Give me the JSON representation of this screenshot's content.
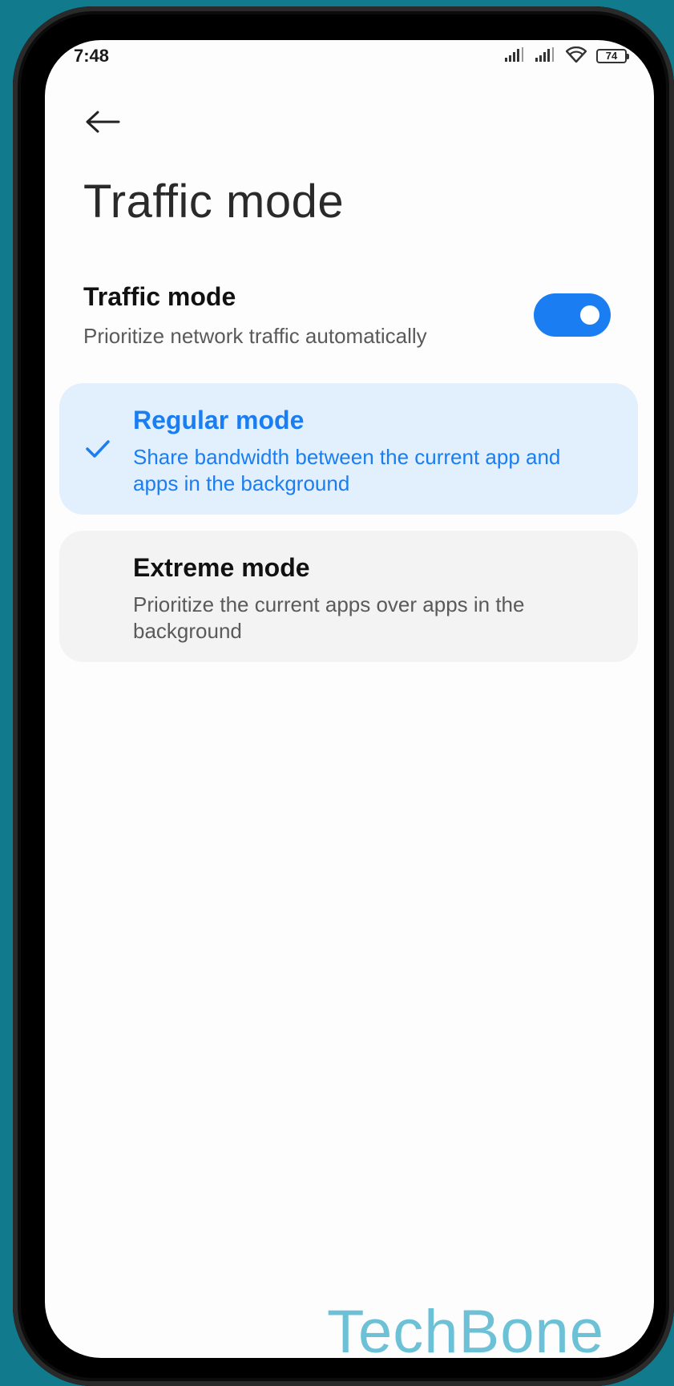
{
  "status_bar": {
    "time": "7:48",
    "battery": "74",
    "icons": [
      "signal-icon",
      "signal-icon",
      "wifi-icon",
      "battery-icon"
    ]
  },
  "header": {
    "back_icon": "arrow-left-icon",
    "title": "Traffic mode"
  },
  "traffic_mode_setting": {
    "title": "Traffic mode",
    "subtitle": "Prioritize network traffic automatically",
    "enabled": true
  },
  "options": [
    {
      "title": "Regular mode",
      "description": "Share bandwidth between the current app and apps in the background",
      "selected": true
    },
    {
      "title": "Extreme mode",
      "description": "Prioritize the current apps over apps in the background",
      "selected": false
    }
  ],
  "colors": {
    "accent": "#1a7ef2",
    "selected_card": "#e2effd",
    "unselected_card": "#f3f3f3",
    "background_teal": "#117a8c",
    "watermark": "#6cc1d6"
  },
  "watermark": "TechBone"
}
